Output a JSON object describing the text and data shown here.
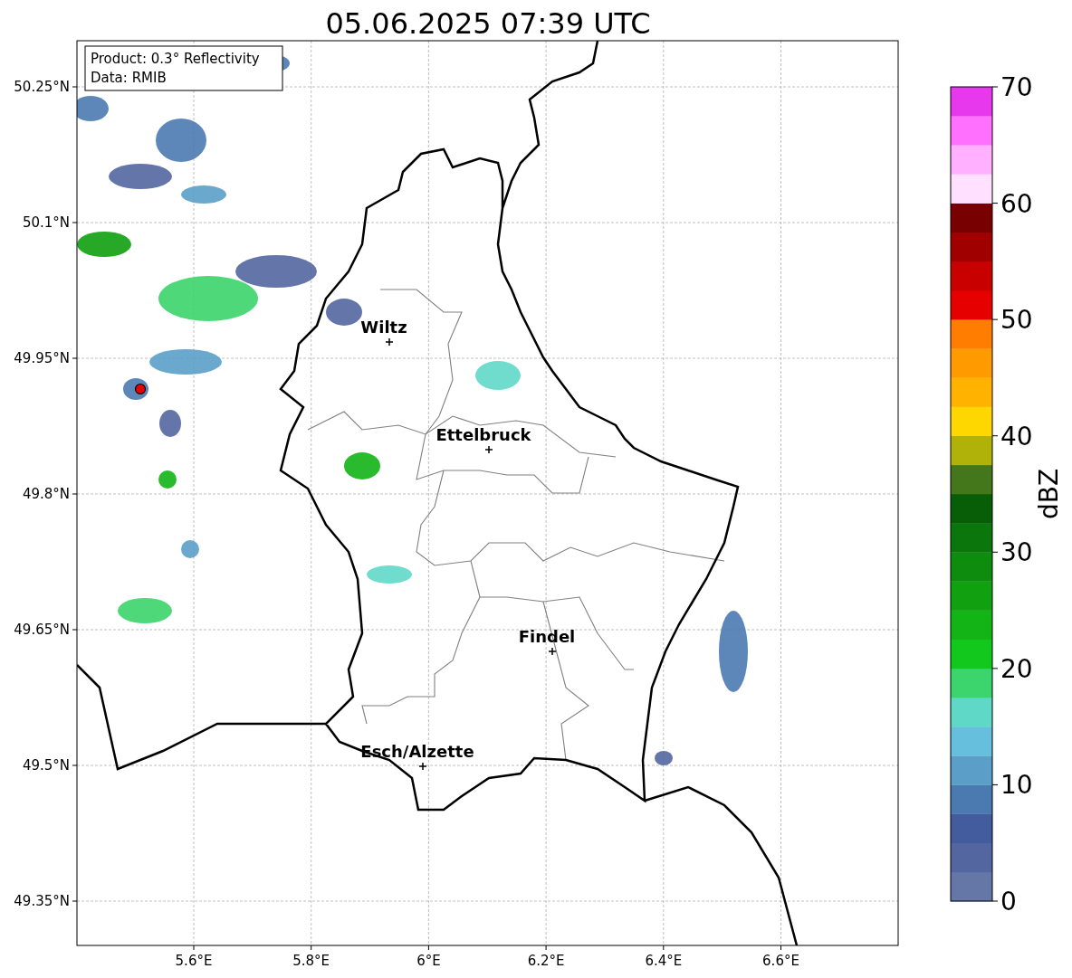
{
  "title": "05.06.2025 07:39 UTC",
  "map": {
    "legend": [
      "Product: 0.3° Reflectivity",
      "Data: RMIB"
    ],
    "cities": [
      {
        "name": "Wiltz"
      },
      {
        "name": "Ettelbruck"
      },
      {
        "name": "Findel"
      },
      {
        "name": "Esch/Alzette"
      }
    ],
    "x_ticks": [
      "5.6°E",
      "5.8°E",
      "6°E",
      "6.2°E",
      "6.4°E",
      "6.6°E"
    ],
    "y_ticks": [
      "50.25°N",
      "50.1°N",
      "49.95°N",
      "49.8°N",
      "49.65°N",
      "49.5°N",
      "49.35°N"
    ]
  },
  "colorbar": {
    "label": "dBZ",
    "ticks": [
      "70",
      "60",
      "50",
      "40",
      "30",
      "20",
      "10",
      "0"
    ],
    "bands": [
      {
        "color": "#6477a7"
      },
      {
        "color": "#5366a0"
      },
      {
        "color": "#435c9e"
      },
      {
        "color": "#4a7ab0"
      },
      {
        "color": "#5b9ec8"
      },
      {
        "color": "#66c0dd"
      },
      {
        "color": "#60d8c8"
      },
      {
        "color": "#3cd46c"
      },
      {
        "color": "#12c81c"
      },
      {
        "color": "#12b416"
      },
      {
        "color": "#10a010"
      },
      {
        "color": "#0e8c0e"
      },
      {
        "color": "#0b760b"
      },
      {
        "color": "#075e07"
      },
      {
        "color": "#44761b"
      },
      {
        "color": "#b0b20a"
      },
      {
        "color": "#ffd700"
      },
      {
        "color": "#ffb300"
      },
      {
        "color": "#ff9a00"
      },
      {
        "color": "#ff7d00"
      },
      {
        "color": "#e60000"
      },
      {
        "color": "#c80000"
      },
      {
        "color": "#a00000"
      },
      {
        "color": "#780000"
      },
      {
        "color": "#ffe0ff"
      },
      {
        "color": "#ffb0ff"
      },
      {
        "color": "#ff70ff"
      },
      {
        "color": "#e838ee"
      }
    ]
  }
}
